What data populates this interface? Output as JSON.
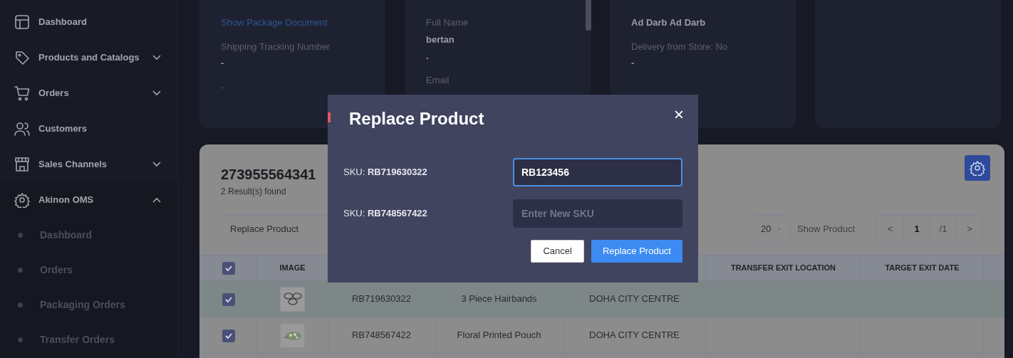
{
  "sidebar": {
    "items": [
      {
        "label": "Dashboard",
        "kind": "layout"
      },
      {
        "label": "Products and Catalogs",
        "kind": "tag",
        "expanded": false
      },
      {
        "label": "Orders",
        "kind": "cart",
        "expanded": false
      },
      {
        "label": "Customers",
        "kind": "people"
      },
      {
        "label": "Sales Channels",
        "kind": "store",
        "expanded": false
      },
      {
        "label": "Akinon OMS",
        "kind": "badge",
        "expanded": true,
        "children": [
          {
            "label": "Dashboard"
          },
          {
            "label": "Orders"
          },
          {
            "label": "Packaging Orders"
          },
          {
            "label": "Transfer Orders"
          }
        ]
      }
    ]
  },
  "info_cards": [
    {
      "lines": [
        {
          "kind": "link",
          "text": "Show Package Document"
        },
        {
          "kind": "label",
          "text": "Shipping Tracking Number"
        },
        {
          "kind": "value",
          "text": "-"
        },
        {
          "kind": "link",
          "text": "-"
        }
      ]
    },
    {
      "lines": [
        {
          "kind": "label",
          "text": "Full Name"
        },
        {
          "kind": "value",
          "text": "bertan"
        },
        {
          "kind": "value",
          "text": "."
        },
        {
          "kind": "label",
          "text": "Email"
        }
      ]
    },
    {
      "lines": [
        {
          "kind": "value",
          "text": "Ad Darb Ad Darb"
        },
        {
          "kind": "label",
          "text": "Delivery from Store: No"
        },
        {
          "kind": "value",
          "text": "-"
        }
      ]
    }
  ],
  "panel": {
    "title": "273955564341",
    "results": "2 Result(s) found",
    "action_select": "Replace Product",
    "page_size": "20",
    "page_size_label": "Show Product",
    "pagination": {
      "prev": "<",
      "page": "1",
      "total": "/1",
      "next": ">"
    }
  },
  "table": {
    "all_checked": true,
    "columns": [
      "IMAGE",
      "",
      "",
      "",
      "TRANSFER EXIT LOCATION",
      "TARGET EXIT DATE"
    ],
    "rows": [
      {
        "checked": true,
        "selected": true,
        "sku": "RB719630322",
        "name": "3 Piece Hairbands",
        "location": "DOHA CITY CENTRE"
      },
      {
        "checked": true,
        "selected": false,
        "sku": "RB748567422",
        "name": "Floral Printed Pouch",
        "location": "DOHA CITY CENTRE"
      }
    ]
  },
  "modal": {
    "title": "Replace Product",
    "close": "×",
    "rows": [
      {
        "label": "SKU: **RB719630322**",
        "value": "RB123456",
        "focused": true
      },
      {
        "label": "SKU: **RB748567422**",
        "value": "",
        "placeholder": "Enter New SKU",
        "focused": false
      }
    ],
    "buttons": [
      {
        "kind": "secondary",
        "label": "Cancel"
      },
      {
        "kind": "primary",
        "label": "Replace Product"
      }
    ]
  }
}
